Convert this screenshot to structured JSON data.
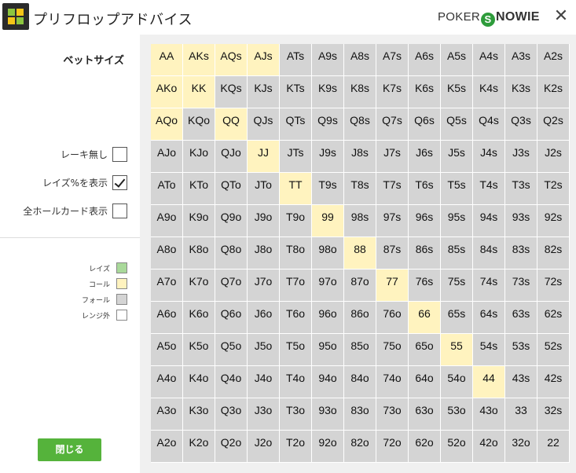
{
  "window": {
    "title": "プリフロップアドバイス",
    "brand_prefix": "POKER",
    "brand_mark": "S",
    "brand_suffix": "NOWIE",
    "close_symbol": "✕"
  },
  "sidebar": {
    "bet_size_label": "ベットサイズ",
    "options": [
      {
        "label": "レーキ無し",
        "checked": false
      },
      {
        "label": "レイズ%を表示",
        "checked": true
      },
      {
        "label": "全ホールカード表示",
        "checked": false
      }
    ],
    "legend": [
      {
        "label": "レイズ",
        "color": "#a9d99a"
      },
      {
        "label": "コール",
        "color": "#fff3bf"
      },
      {
        "label": "フォール",
        "color": "#d4d4d4"
      },
      {
        "label": "レンジ外",
        "color": "#ffffff"
      }
    ],
    "close_button": "閉じる"
  },
  "grid": {
    "cells": [
      [
        "AA",
        "AKs",
        "AQs",
        "AJs",
        "ATs",
        "A9s",
        "A8s",
        "A7s",
        "A6s",
        "A5s",
        "A4s",
        "A3s",
        "A2s"
      ],
      [
        "AKo",
        "KK",
        "KQs",
        "KJs",
        "KTs",
        "K9s",
        "K8s",
        "K7s",
        "K6s",
        "K5s",
        "K4s",
        "K3s",
        "K2s"
      ],
      [
        "AQo",
        "KQo",
        "QQ",
        "QJs",
        "QTs",
        "Q9s",
        "Q8s",
        "Q7s",
        "Q6s",
        "Q5s",
        "Q4s",
        "Q3s",
        "Q2s"
      ],
      [
        "AJo",
        "KJo",
        "QJo",
        "JJ",
        "JTs",
        "J9s",
        "J8s",
        "J7s",
        "J6s",
        "J5s",
        "J4s",
        "J3s",
        "J2s"
      ],
      [
        "ATo",
        "KTo",
        "QTo",
        "JTo",
        "TT",
        "T9s",
        "T8s",
        "T7s",
        "T6s",
        "T5s",
        "T4s",
        "T3s",
        "T2s"
      ],
      [
        "A9o",
        "K9o",
        "Q9o",
        "J9o",
        "T9o",
        "99",
        "98s",
        "97s",
        "96s",
        "95s",
        "94s",
        "93s",
        "92s"
      ],
      [
        "A8o",
        "K8o",
        "Q8o",
        "J8o",
        "T8o",
        "98o",
        "88",
        "87s",
        "86s",
        "85s",
        "84s",
        "83s",
        "82s"
      ],
      [
        "A7o",
        "K7o",
        "Q7o",
        "J7o",
        "T7o",
        "97o",
        "87o",
        "77",
        "76s",
        "75s",
        "74s",
        "73s",
        "72s"
      ],
      [
        "A6o",
        "K6o",
        "Q6o",
        "J6o",
        "T6o",
        "96o",
        "86o",
        "76o",
        "66",
        "65s",
        "64s",
        "63s",
        "62s"
      ],
      [
        "A5o",
        "K5o",
        "Q5o",
        "J5o",
        "T5o",
        "95o",
        "85o",
        "75o",
        "65o",
        "55",
        "54s",
        "53s",
        "52s"
      ],
      [
        "A4o",
        "K4o",
        "Q4o",
        "J4o",
        "T4o",
        "94o",
        "84o",
        "74o",
        "64o",
        "54o",
        "44",
        "43s",
        "42s"
      ],
      [
        "A3o",
        "K3o",
        "Q3o",
        "J3o",
        "T3o",
        "93o",
        "83o",
        "73o",
        "63o",
        "53o",
        "43o",
        "33",
        "32s"
      ],
      [
        "A2o",
        "K2o",
        "Q2o",
        "J2o",
        "T2o",
        "92o",
        "82o",
        "72o",
        "62o",
        "52o",
        "42o",
        "32o",
        "22"
      ]
    ],
    "call_hands": [
      "AA",
      "AKs",
      "AQs",
      "AJs",
      "AKo",
      "KK",
      "AQo",
      "QQ",
      "JJ",
      "TT",
      "99",
      "88",
      "77",
      "66",
      "55",
      "44"
    ]
  }
}
